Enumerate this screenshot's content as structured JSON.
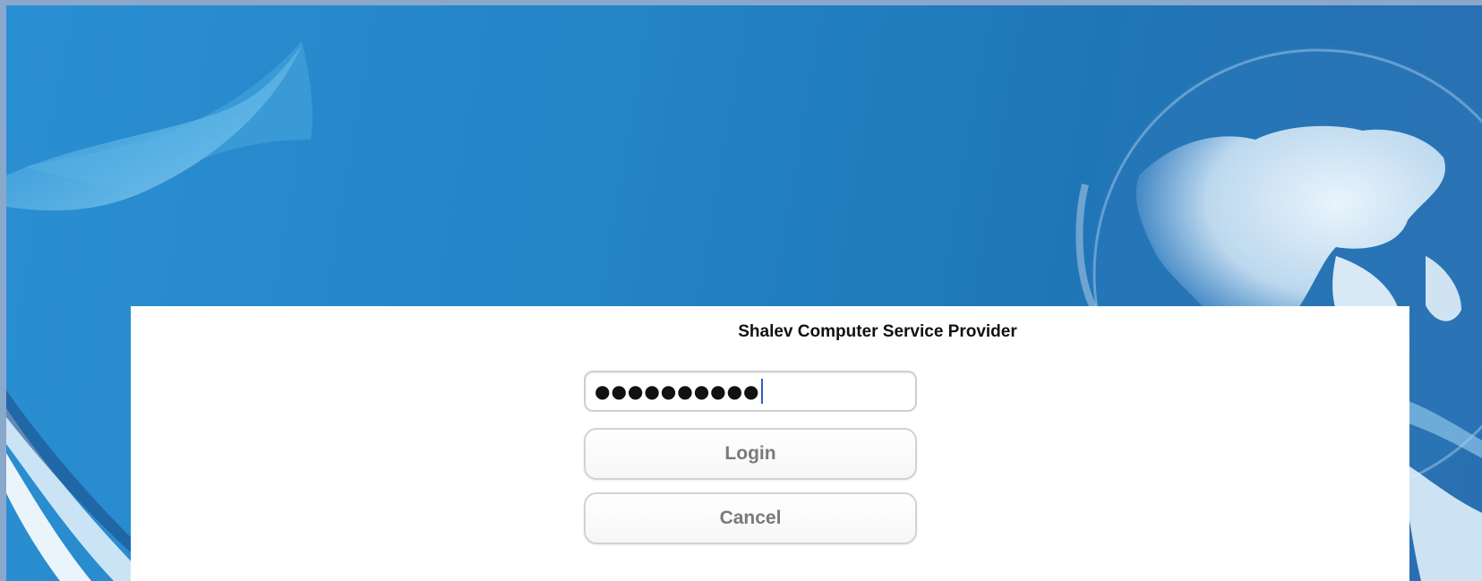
{
  "login_dialog": {
    "title": "Shalev Computer Service Provider",
    "password_value": "●●●●●●●●●●",
    "login_label": "Login",
    "cancel_label": "Cancel"
  },
  "colors": {
    "background_blue": "#2384c6",
    "panel": "#ffffff",
    "button_text": "#7a7a7a"
  },
  "icons": {
    "background_art": "globe-illustration"
  }
}
